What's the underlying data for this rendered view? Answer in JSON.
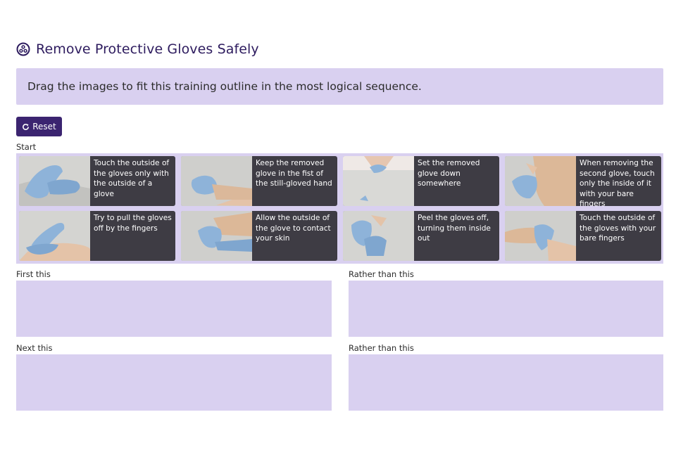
{
  "header": {
    "title": "Remove Protective Gloves Safely",
    "icon": "activity-icon"
  },
  "instructions": "Drag the images to fit this training outline in the most logical sequence.",
  "toolbar": {
    "reset_label": "Reset",
    "reset_icon": "refresh-icon"
  },
  "start": {
    "label": "Start"
  },
  "cards": [
    {
      "caption": "Touch the outside of the gloves only with the outside of a glove"
    },
    {
      "caption": "Keep the removed glove in the fist of the still-gloved hand"
    },
    {
      "caption": "Set the removed glove down somewhere"
    },
    {
      "caption": "When removing the second glove, touch only the inside of it with your bare fingers"
    },
    {
      "caption": "Try to pull the gloves off by the fingers"
    },
    {
      "caption": "Allow the outside of the glove to contact your skin"
    },
    {
      "caption": "Peel the gloves off, turning them inside out"
    },
    {
      "caption": "Touch the outside of the gloves with your bare fingers"
    }
  ],
  "zones": [
    {
      "label": "First this"
    },
    {
      "label": "Rather than this"
    },
    {
      "label": "Next this"
    },
    {
      "label": "Rather than this"
    }
  ],
  "colors": {
    "accent": "#3b2470",
    "zone_bg": "#d9d0f0",
    "card_bg": "#3e3c44",
    "title": "#2d1b5e",
    "glove": "#8eb3d9"
  }
}
